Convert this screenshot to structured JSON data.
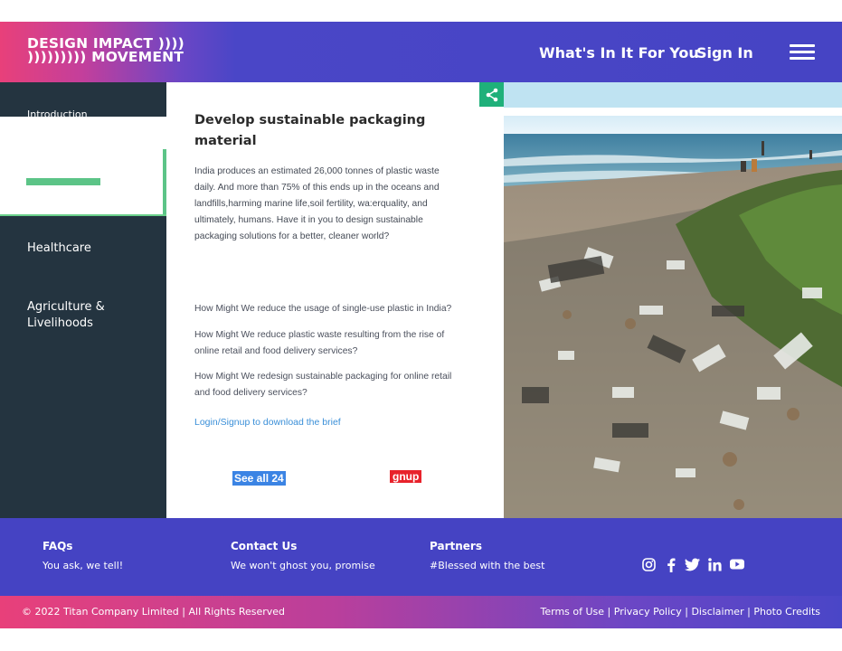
{
  "header": {
    "logo_line1": "DESIGN IMPACT ))))",
    "logo_line2": "))))))))) MOVEMENT",
    "nav_whats_in_it": "What's In It For You",
    "nav_sign_in": "Sign In",
    "menu_icon": "hamburger-menu-icon"
  },
  "sidebar": {
    "items": [
      {
        "label": "Introduction"
      },
      {
        "label": "Healthcare"
      },
      {
        "label": "Agriculture &"
      },
      {
        "label": "Livelihoods"
      }
    ]
  },
  "main": {
    "title_line1": "Develop sustainable  packaging",
    "title_line2": "material",
    "description": [
      "India produces an estimated 26,000 tonnes of  plastic waste",
      "daily. And more than 75% of this ends up in the oceans and",
      "landfills,harming marine life,soil fertility, wa:erquality, and",
      "ultimately,  humans. Have it  in you to design sustainable",
      "packaging solutions for a better, cleaner world?"
    ],
    "hmw": [
      {
        "line1": "How  Might We reduce the usage of single-use plastic in India?",
        "line2": ""
      },
      {
        "line1": "How  Might We reduce plastic waste resulting from the rise of",
        "line2": "online retail and food delivery services?"
      },
      {
        "line1": "How  Might We redesign sustainable packaging for online retail",
        "line2": "and food delivery services?"
      }
    ],
    "login_link": "Login/Signup to download the brief",
    "see_all_button": "See all 24",
    "signup_button": "gnup"
  },
  "share_icon": "share-icon",
  "footer": {
    "faqs_title": "FAQs",
    "faqs_sub": "You ask, we tell!",
    "contact_title": "Contact Us",
    "contact_sub": "We won't ghost you, promise",
    "partners_title": "Partners",
    "partners_sub": "#Blessed with the best",
    "social": [
      "instagram-icon",
      "facebook-icon",
      "twitter-icon",
      "linkedin-icon",
      "youtube-icon"
    ],
    "copyright": "© 2022 Titan Company Limited | All Rights Reserved",
    "legal": {
      "terms": "Terms of Use",
      "privacy": "Privacy Policy",
      "disclaimer": "Disclaimer",
      "credits": "Photo Credits",
      "separator": " | "
    }
  },
  "colors": {
    "header_blue": "#4644c4",
    "accent_pink": "#e8407a",
    "sidebar_dark": "#243440",
    "accent_green": "#5cc487",
    "link_blue": "#3a8fd8",
    "button_blue": "#3b84e4",
    "button_red": "#e8222b"
  }
}
